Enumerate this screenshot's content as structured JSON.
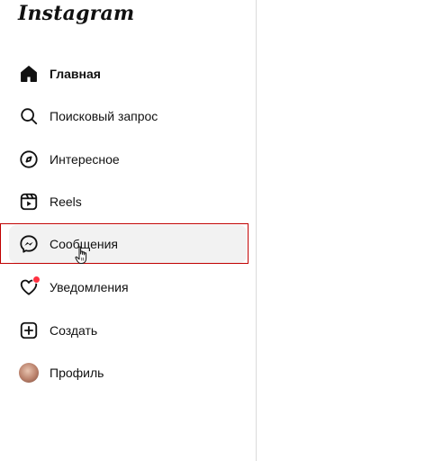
{
  "app": {
    "logo_text": "Instagram"
  },
  "sidebar": {
    "items": [
      {
        "label": "Главная",
        "icon": "home-icon",
        "active": true
      },
      {
        "label": "Поисковый запрос",
        "icon": "search-icon"
      },
      {
        "label": "Интересное",
        "icon": "compass-icon"
      },
      {
        "label": "Reels",
        "icon": "reels-icon"
      },
      {
        "label": "Сообщения",
        "icon": "messenger-icon",
        "hovered": true
      },
      {
        "label": "Уведомления",
        "icon": "heart-icon",
        "has_notification": true
      },
      {
        "label": "Создать",
        "icon": "plus-square-icon"
      },
      {
        "label": "Профиль",
        "icon": "avatar"
      }
    ]
  },
  "colors": {
    "highlight_border": "#c00000",
    "notification_dot": "#ff3040",
    "hover_bg": "#f2f2f2",
    "divider": "#dbdbdb"
  }
}
